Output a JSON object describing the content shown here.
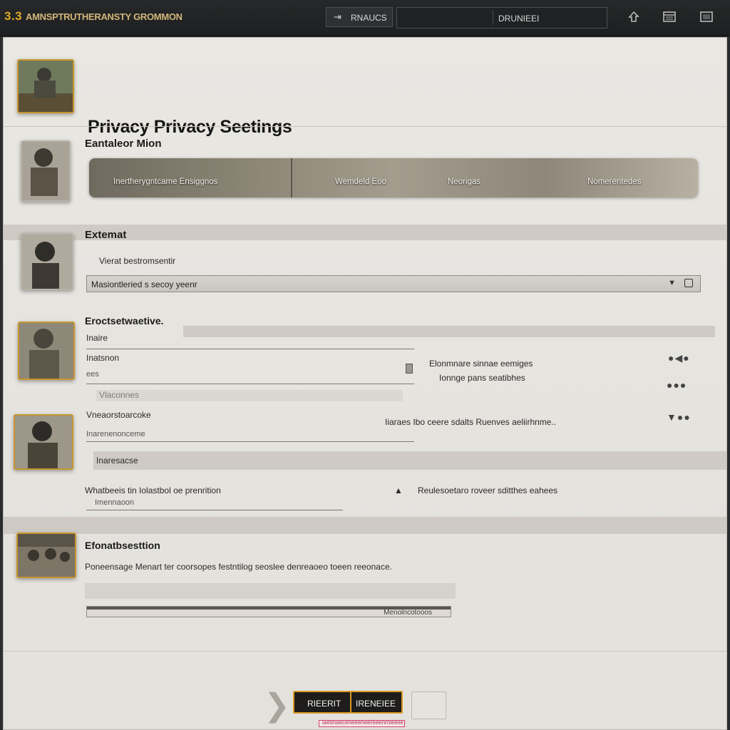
{
  "topbar": {
    "brand_number": "3.3",
    "brand_name": "AMNSPTRUTHERANSTY GROMMON",
    "nav_tab": "RNAUCS",
    "search_label": "DRUNIEEI",
    "icons": [
      "refresh-icon",
      "display-icon",
      "monitor-icon"
    ]
  },
  "page": {
    "title": "Privacy Privacy Seetings"
  },
  "section_media": {
    "heading": "Eantaleor Mion",
    "strip": [
      "Inertherygntcame Ensiggnos",
      "Wemdeld Eoo",
      "Neorigas",
      "Nomerentedes"
    ]
  },
  "section_external": {
    "heading": "Extemat",
    "label": "Vierat bestromsentir",
    "dropdown_value": "Masiontleried s secoy yeenr"
  },
  "section_fields": {
    "heading": "Eroctsetwaetive.",
    "field1_label": "Inaire",
    "field2_label": "Inatsnon",
    "field2_value": "ees",
    "sub_label": "Vlaconnes",
    "field3_label": "Vneaorstoarcoke",
    "field3_value": "Inarenenonceme",
    "band_label": "Inaresacse",
    "right_option1_line1": "Elonmnare sinnae eemiges",
    "right_option1_line2": "Ionnge pans seatibhes",
    "right_option2": "Iiaraes  Ibo ceere sdalts Ruenves aeliirhnme..",
    "field4_label": "Whatbeeis tin Iolastbol oe prenrition",
    "field4_placeholder": "Imennaoon",
    "right_option3": "Reulesoetaro roveer sditthes eahees"
  },
  "section_notifications": {
    "heading": "Efonatbsesttion",
    "description": "Poneensage  Menart ter coorsopes festntilog seoslee denreaoeo toeen reeonace.",
    "progress_label": "Menolncotooos"
  },
  "footer": {
    "primary_left": "RIEERIT",
    "primary_right": "IRENEIEE",
    "link_text": "iaesnaeceneeeneereeenroieeiie"
  },
  "colors": {
    "accent": "#d99a25",
    "brand_gold": "#e0a92a",
    "panel_bg": "#e7e5e0",
    "topbar_bg": "#232526",
    "link_red": "#d8406b"
  }
}
